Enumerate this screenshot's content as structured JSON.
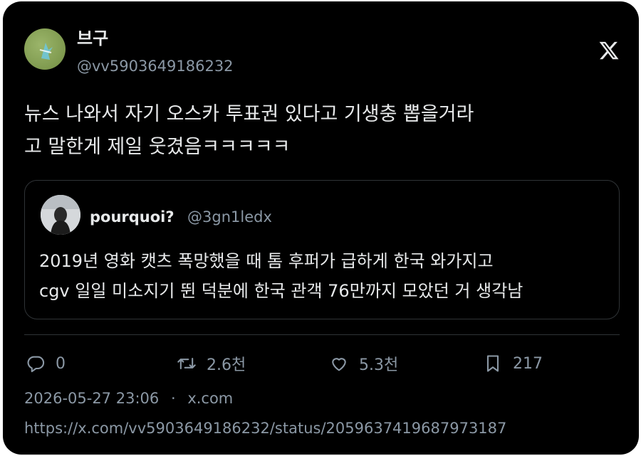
{
  "author": {
    "display_name": "브구",
    "handle": "@vv5903649186232"
  },
  "brand_icon": "x-logo-icon",
  "tweet": {
    "lines": [
      "뉴스 나와서 자기 오스카 투표권 있다고 기생충 뽑을거라",
      "고 말한게 제일 웃겼음ㅋㅋㅋㅋㅋ"
    ]
  },
  "quote": {
    "display_name": "pourquoi?",
    "handle": "@3gn1ledx",
    "lines": [
      "2019년 영화 캣츠 폭망했을 때 톰 후퍼가 급하게 한국 와가지고",
      "cgv 일일 미소지기 뛴 덕분에 한국 관객 76만까지 모았던 거 생각남"
    ]
  },
  "actions": {
    "reply": {
      "icon": "reply-icon",
      "count": "0"
    },
    "retweet": {
      "icon": "retweet-icon",
      "count": "2.6천"
    },
    "like": {
      "icon": "heart-icon",
      "count": "5.3천"
    },
    "bookmark": {
      "icon": "bookmark-icon",
      "count": "217"
    }
  },
  "meta": {
    "timestamp": "2026-05-27 23:06",
    "separator": "·",
    "source": "x.com"
  },
  "url": "https://x.com/vv5903649186232/status/2059637419687973187",
  "colors": {
    "background": "#000000",
    "text_primary": "#e7e9ea",
    "text_secondary": "#8b98a5",
    "border": "#2f3336"
  }
}
